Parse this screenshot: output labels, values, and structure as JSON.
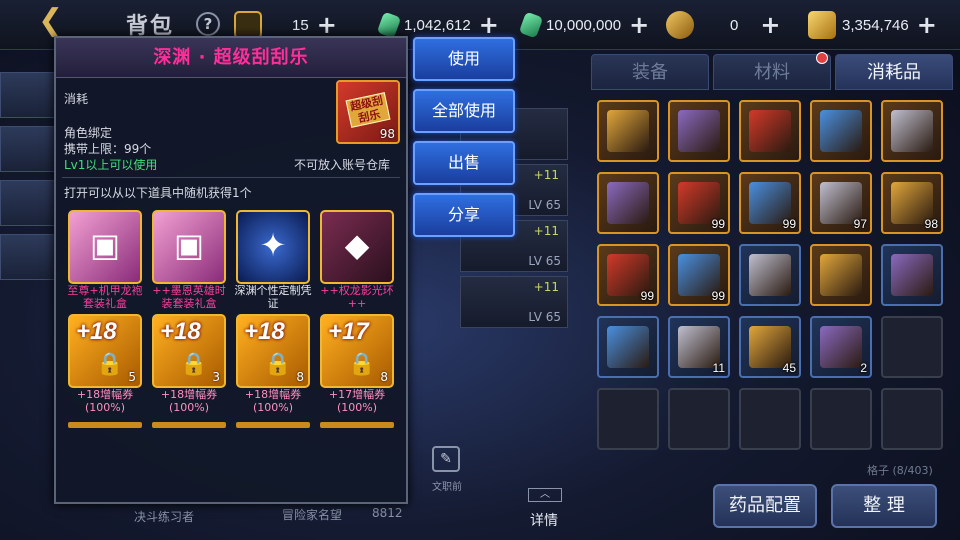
{
  "topbar": {
    "back_icon": "back-arrow-icon",
    "title": "背包",
    "help": "?",
    "currencies": [
      {
        "icon": "coin-token-icon",
        "value": "15",
        "color": "#d8a93a"
      },
      {
        "icon": "green-crystal-icon",
        "value": "1,042,612",
        "color": "#3ac07a"
      },
      {
        "icon": "green-crystal-icon",
        "value": "10,000,000",
        "color": "#3ac07a"
      },
      {
        "icon": "gold-ticket-icon",
        "value": "0",
        "color": "#d8a93a"
      },
      {
        "icon": "gold-bar-icon",
        "value": "3,354,746",
        "color": "#d8a93a"
      }
    ]
  },
  "right_tabs": [
    {
      "label": "装备",
      "active": false
    },
    {
      "label": "材料",
      "active": false
    },
    {
      "label": "消耗品",
      "active": true
    }
  ],
  "grid": {
    "rows": [
      [
        {
          "type": "filled",
          "qty": ""
        },
        {
          "type": "filled",
          "qty": ""
        },
        {
          "type": "filled",
          "qty": ""
        },
        {
          "type": "filled",
          "qty": ""
        },
        {
          "type": "filled",
          "qty": ""
        }
      ],
      [
        {
          "type": "filled",
          "qty": ""
        },
        {
          "type": "filled",
          "qty": "99"
        },
        {
          "type": "filled",
          "qty": "99"
        },
        {
          "type": "filled",
          "qty": "97"
        },
        {
          "type": "filled",
          "qty": "98"
        }
      ],
      [
        {
          "type": "filled",
          "qty": "99"
        },
        {
          "type": "filled",
          "qty": "99"
        },
        {
          "type": "blue",
          "qty": ""
        },
        {
          "type": "filled",
          "qty": ""
        },
        {
          "type": "blue",
          "qty": ""
        }
      ],
      [
        {
          "type": "blue",
          "qty": ""
        },
        {
          "type": "blue",
          "qty": "11"
        },
        {
          "type": "blue",
          "qty": "45"
        },
        {
          "type": "blue",
          "qty": "2"
        },
        {
          "type": "empty",
          "qty": ""
        }
      ],
      [
        {
          "type": "empty",
          "qty": ""
        },
        {
          "type": "empty",
          "qty": ""
        },
        {
          "type": "empty",
          "qty": ""
        },
        {
          "type": "empty",
          "qty": ""
        },
        {
          "type": "empty",
          "qty": ""
        }
      ]
    ],
    "slots_label": "格子 (8/403)"
  },
  "buttons": {
    "potion": "药品配置",
    "sort": "整 理"
  },
  "char_list": [
    {
      "plus": "",
      "lv": ""
    },
    {
      "plus": "+11",
      "lv": "LV 65"
    },
    {
      "plus": "+11",
      "lv": "LV 65"
    },
    {
      "plus": "+11",
      "lv": "LV 65"
    }
  ],
  "bottom": {
    "left_text": "决斗练习者",
    "mid_text": "冒险家名望",
    "mid_value": "8812",
    "edit_text": "文职前",
    "detail": "详情"
  },
  "popup": {
    "title": "深渊 · 超级刮刮乐",
    "category": "消耗",
    "bind": "角色绑定",
    "carry_limit": "携带上限：99个",
    "level_req": "Lv1以上可以使用",
    "no_store": "不可放入账号仓库",
    "hero_label": "超级刮刮乐",
    "hero_qty": "98",
    "random_desc": "打开可以从以下道具中随机获得1个",
    "rewards": [
      {
        "style": "pink",
        "top": "",
        "glyph": "▣",
        "qty": "",
        "label": "至尊+机甲龙袍套装礼盒",
        "label_color": "magenta"
      },
      {
        "style": "pink",
        "top": "",
        "glyph": "▣",
        "qty": "",
        "label": "++墨恩英雄时装套装礼盒",
        "label_color": "magenta"
      },
      {
        "style": "rune",
        "top": "",
        "glyph": "✦",
        "qty": "",
        "label": "深渊个性定制凭证",
        "label_color": "white"
      },
      {
        "style": "wolf",
        "top": "",
        "glyph": "◆",
        "qty": "",
        "label": "++权龙影光环++",
        "label_color": "magenta"
      },
      {
        "style": "plus",
        "top": "+18",
        "glyph": "",
        "qty": "5",
        "label": "+18增幅券(100%)",
        "label_color": "pink"
      },
      {
        "style": "plus",
        "top": "+18",
        "glyph": "",
        "qty": "3",
        "label": "+18增幅券(100%)",
        "label_color": "pink"
      },
      {
        "style": "plus",
        "top": "+18",
        "glyph": "",
        "qty": "8",
        "label": "+18增幅券(100%)",
        "label_color": "pink"
      },
      {
        "style": "plus",
        "top": "+17",
        "glyph": "",
        "qty": "8",
        "label": "+17增幅券(100%)",
        "label_color": "pink"
      }
    ]
  },
  "actions": [
    "使用",
    "全部使用",
    "出售",
    "分享"
  ],
  "colors": {
    "accent_blue": "#2f6fe0",
    "title_pink": "#ff2e9a",
    "green_text": "#3fe07a",
    "gold_border": "#f0b830"
  }
}
